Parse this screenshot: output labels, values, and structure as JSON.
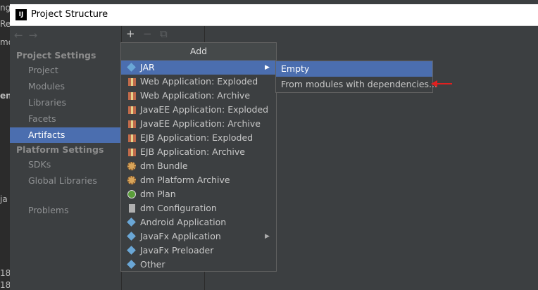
{
  "window": {
    "title": "Project Structure",
    "app_icon_text": "IJ"
  },
  "background_fragments": [
    "ng",
    "Re",
    "mo",
    "en",
    "ja",
    "18",
    "18"
  ],
  "sidebar": {
    "nav": {
      "back": "←",
      "forward": "→"
    },
    "project_settings_header": "Project Settings",
    "project_items": [
      "Project",
      "Modules",
      "Libraries",
      "Facets",
      "Artifacts"
    ],
    "selected_item": "Artifacts",
    "platform_settings_header": "Platform Settings",
    "platform_items": [
      "SDKs",
      "Global Libraries"
    ],
    "problems": "Problems"
  },
  "toolbar": {
    "add": "+",
    "remove": "−",
    "copy": "⧉"
  },
  "add_menu": {
    "header": "Add",
    "items": [
      {
        "label": "JAR",
        "icon": "diamond-icon",
        "submenu": true
      },
      {
        "label": "Web Application: Exploded",
        "icon": "web-app-icon"
      },
      {
        "label": "Web Application: Archive",
        "icon": "web-app-icon"
      },
      {
        "label": "JavaEE Application: Exploded",
        "icon": "javaee-app-icon"
      },
      {
        "label": "JavaEE Application: Archive",
        "icon": "javaee-app-icon"
      },
      {
        "label": "EJB Application: Exploded",
        "icon": "ejb-app-icon"
      },
      {
        "label": "EJB Application: Archive",
        "icon": "ejb-app-icon"
      },
      {
        "label": "dm Bundle",
        "icon": "dm-bundle-icon"
      },
      {
        "label": "dm Platform Archive",
        "icon": "dm-platform-icon"
      },
      {
        "label": "dm Plan",
        "icon": "dm-plan-icon"
      },
      {
        "label": "dm Configuration",
        "icon": "dm-config-icon"
      },
      {
        "label": "Android Application",
        "icon": "diamond-icon"
      },
      {
        "label": "JavaFx Application",
        "icon": "diamond-icon",
        "submenu": true
      },
      {
        "label": "JavaFx Preloader",
        "icon": "diamond-icon"
      },
      {
        "label": "Other",
        "icon": "diamond-icon"
      }
    ]
  },
  "jar_submenu": {
    "items": [
      "Empty",
      "From modules with dependencies..."
    ]
  },
  "colors": {
    "selection": "#4b6eaf",
    "annotation_arrow": "#e02020"
  }
}
